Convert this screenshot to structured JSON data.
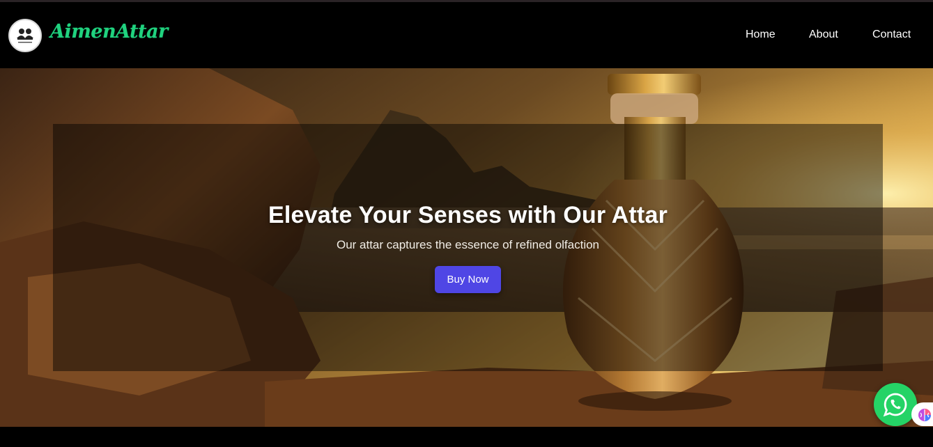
{
  "header": {
    "brand_name": "AimenAttar",
    "logo_text": "AimenAttar",
    "nav": [
      {
        "label": "Home"
      },
      {
        "label": "About"
      },
      {
        "label": "Contact"
      }
    ]
  },
  "hero": {
    "title": "Elevate Your Senses with Our Attar",
    "subtitle": "Our attar captures the essence of refined olfaction",
    "cta_label": "Buy Now"
  },
  "floating": {
    "whatsapp_icon": "whatsapp-icon",
    "side_widget_icon": "brain-icon"
  },
  "colors": {
    "brand": "#20d27f",
    "cta": "#4f46e5",
    "whatsapp": "#25d366",
    "navbar": "#000000"
  }
}
